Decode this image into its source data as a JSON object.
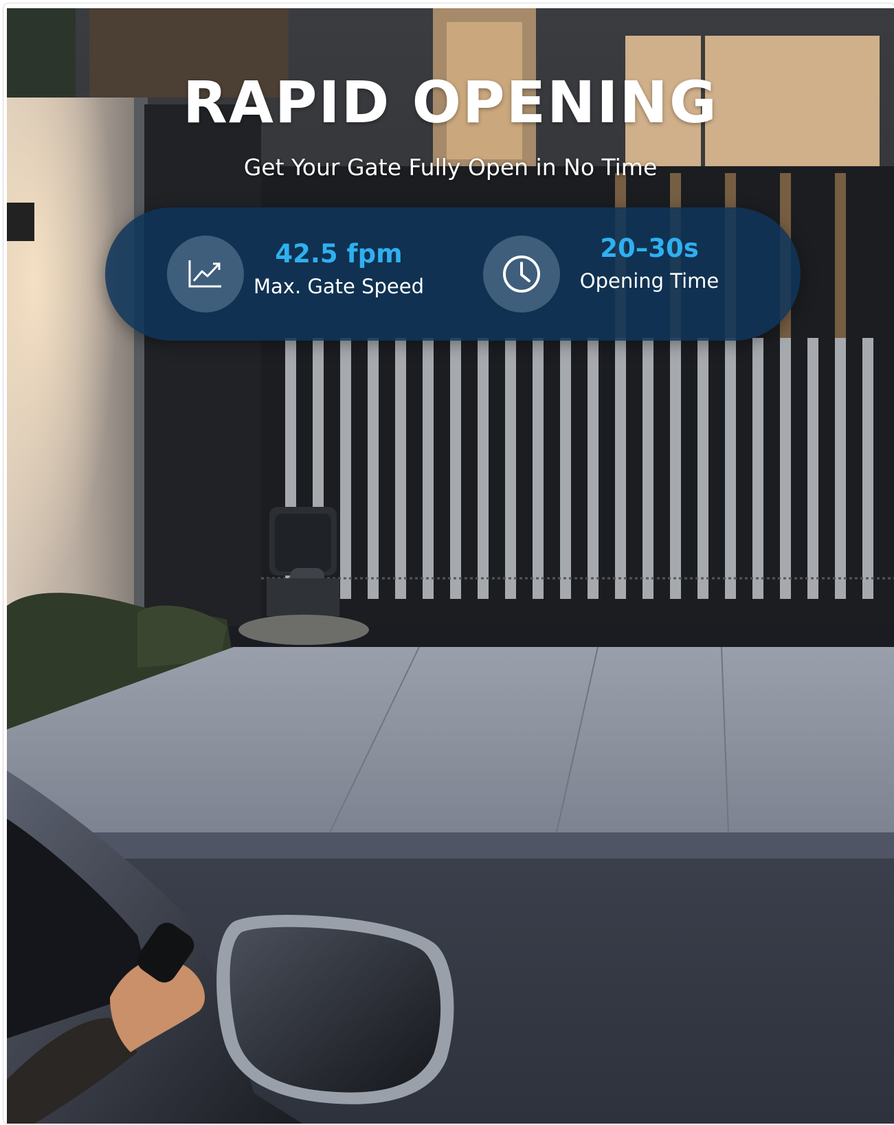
{
  "hero": {
    "title": "RAPID OPENING",
    "subtitle": "Get Your Gate Fully Open in No Time"
  },
  "stats": [
    {
      "icon": "trend-chart-icon",
      "value": "42.5 fpm",
      "label": "Max. Gate Speed"
    },
    {
      "icon": "clock-icon",
      "value": "20–30s",
      "label": "Opening Time"
    }
  ],
  "colors": {
    "accent": "#2fb0ef",
    "pill": "#0e345a",
    "text": "#ffffff"
  }
}
